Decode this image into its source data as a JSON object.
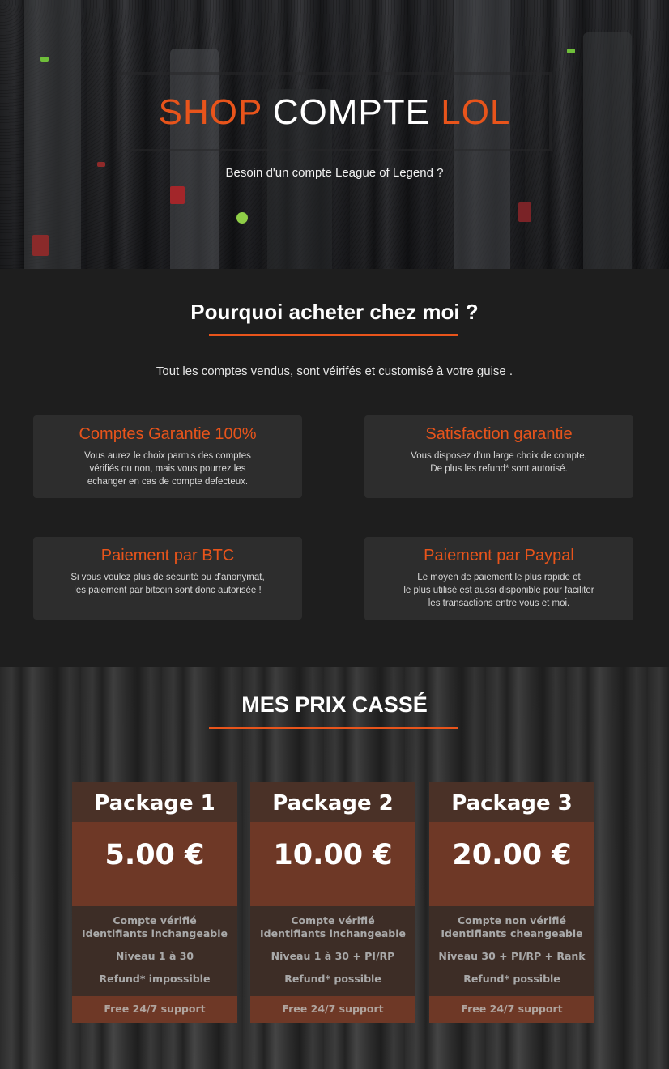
{
  "hero": {
    "title_part1": "SHOP",
    "title_part2": "COMPTE",
    "title_part3": "LOL",
    "tagline": "Besoin d'un compte League of Legend ?"
  },
  "why": {
    "title": "Pourquoi acheter chez moi ?",
    "intro": "Tout les comptes vendus, sont véirifés et customisé à votre guise .",
    "features": [
      {
        "title": "Comptes Garantie 100%",
        "description": "Vous aurez le choix parmis des comptes\nvérifiés ou non, mais vous pourrez les\nechanger en cas de compte defecteux."
      },
      {
        "title": "Satisfaction garantie",
        "description": "Vous disposez d'un large choix de compte,\nDe plus les refund* sont autorisé."
      },
      {
        "title": "Paiement par BTC",
        "description": "Si vous voulez plus de sécurité ou d'anonymat,\nles paiement par bitcoin sont donc autorisée !"
      },
      {
        "title": "Paiement par Paypal",
        "description": "Le moyen de paiement le plus rapide et\nle plus utilisé est aussi disponible pour faciliter\nles transactions entre vous et moi."
      }
    ]
  },
  "prices": {
    "title": "MES PRIX CASSÉ",
    "packages": [
      {
        "name": "Package 1",
        "price": "5.00 €",
        "line1": "Compte vérifié",
        "line2": "Identifiants inchangeable",
        "level": "Niveau 1 à 30",
        "refund": "Refund* impossible",
        "support": "Free 24/7 support"
      },
      {
        "name": "Package 2",
        "price": "10.00 €",
        "line1": "Compte vérifié",
        "line2": "Identifiants inchangeable",
        "level": "Niveau 1 à 30 + PI/RP",
        "refund": "Refund* possible",
        "support": "Free 24/7 support"
      },
      {
        "name": "Package 3",
        "price": "20.00 €",
        "line1": "Compte non vérifié",
        "line2": "Identifiants cheangeable",
        "level": "Niveau 30 + PI/RP + Rank",
        "refund": "Refund* possible",
        "support": "Free 24/7 support"
      }
    ]
  },
  "colors": {
    "accent": "#e8541b",
    "dark_bg": "#1e1e1e",
    "card_bg": "#2d2d2d",
    "pkg_head": "#4a3127",
    "pkg_price": "#6e3826",
    "pkg_body": "#3d2d26"
  }
}
